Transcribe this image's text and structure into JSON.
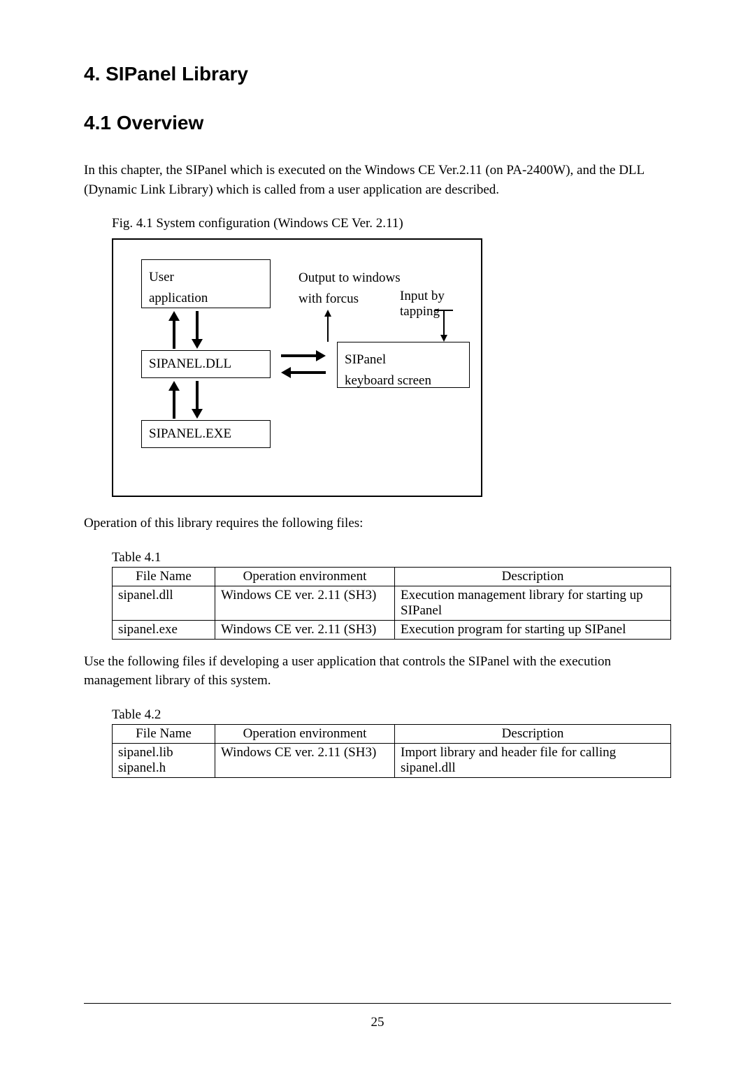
{
  "headings": {
    "h1": "4.   SIPanel Library",
    "h2": "4.1   Overview"
  },
  "paragraphs": {
    "p1": "In this chapter, the SIPanel which is executed on the Windows CE Ver.2.11 (on PA-2400W), and the DLL (Dynamic Link Library) which is called from a user application are described.",
    "figcap": "Fig. 4.1    System configuration (Windows CE Ver. 2.11)",
    "p2": "Operation of this library requires the following files:",
    "p3": "Use the following files if developing a user application that controls the SIPanel with the execution management library of this system."
  },
  "diagram": {
    "user_app_l1": "User",
    "user_app_l2": "application",
    "output_l1": "Output to windows",
    "output_l2": "with forcus",
    "input": "Input by tapping",
    "dll": "SIPANEL.DLL",
    "sipanel_l1": "SIPanel",
    "sipanel_l2": "keyboard screen",
    "exe": "SIPANEL.EXE"
  },
  "table1": {
    "caption": "Table 4.1",
    "headers": {
      "file": "File Name",
      "env": "Operation environment",
      "desc": "Description"
    },
    "rows": [
      {
        "file": "sipanel.dll",
        "env": "Windows CE ver. 2.11 (SH3)",
        "desc": "Execution management library for starting up SIPanel"
      },
      {
        "file": "sipanel.exe",
        "env": "Windows CE ver. 2.11 (SH3)",
        "desc": "Execution program for starting up SIPanel"
      }
    ]
  },
  "table2": {
    "caption": "Table 4.2",
    "headers": {
      "file": "File Name",
      "env": "Operation environment",
      "desc": "Description"
    },
    "rows": [
      {
        "file": "sipanel.lib",
        "env": "Windows CE ver. 2.11 (SH3)",
        "desc": "Import library and header file for calling sipanel.dll"
      },
      {
        "file": "sipanel.h",
        "env": "",
        "desc": ""
      }
    ]
  },
  "page_number": "25"
}
